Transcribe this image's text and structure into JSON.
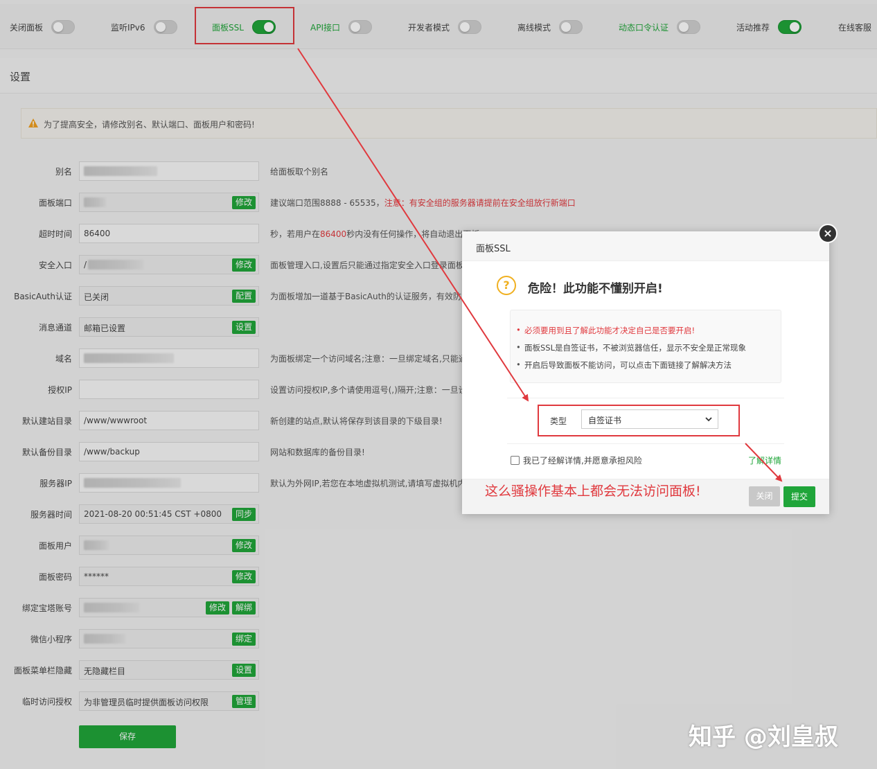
{
  "toggles": [
    {
      "label": "关闭面板",
      "on": false,
      "accent": false
    },
    {
      "label": "监听IPv6",
      "on": false,
      "accent": false
    },
    {
      "label": "面板SSL",
      "on": true,
      "accent": true
    },
    {
      "label": "API接口",
      "on": false,
      "accent": true
    },
    {
      "label": "开发者模式",
      "on": false,
      "accent": false
    },
    {
      "label": "离线模式",
      "on": false,
      "accent": false
    },
    {
      "label": "动态口令认证",
      "on": false,
      "accent": true
    },
    {
      "label": "活动推荐",
      "on": true,
      "accent": false
    },
    {
      "label": "在线客服",
      "on": false,
      "accent": false
    }
  ],
  "settings": {
    "title": "设置",
    "warning": "为了提高安全，请修改别名、默认端口、面板用户和密码!",
    "rows": [
      {
        "label": "别名",
        "value": "",
        "hint": "给面板取个别名"
      },
      {
        "label": "面板端口",
        "value": "",
        "btn": "修改",
        "hint": "建议端口范围8888 - 65535，",
        "hint_red": "注意：有安全组的服务器请提前在安全组放行新端口"
      },
      {
        "label": "超时时间",
        "value": "86400",
        "hint": "秒，若用户在",
        "hint_red": "86400",
        "hint_after": "秒内没有任何操作，将自动退出面板"
      },
      {
        "label": "安全入口",
        "value": "/",
        "btn": "修改",
        "hint": "面板管理入口,设置后只能通过指定安全入口登录面板"
      },
      {
        "label": "BasicAuth认证",
        "value": "已关闭",
        "btn": "配置",
        "hint": "为面板增加一道基于BasicAuth的认证服务，有效防"
      },
      {
        "label": "消息通道",
        "value": "邮箱已设置",
        "btn": "设置",
        "hint": ""
      },
      {
        "label": "域名",
        "value": "",
        "hint": "为面板绑定一个访问域名;注意：一旦绑定域名,只能通"
      },
      {
        "label": "授权IP",
        "value": "",
        "hint": "设置访问授权IP,多个请使用逗号(,)隔开;注意：一旦设"
      },
      {
        "label": "默认建站目录",
        "value": "/www/wwwroot",
        "hint": "新创建的站点,默认将保存到该目录的下级目录!"
      },
      {
        "label": "默认备份目录",
        "value": "/www/backup",
        "hint": "网站和数据库的备份目录!"
      },
      {
        "label": "服务器IP",
        "value": "",
        "hint": "默认为外网IP,若您在本地虚拟机测试,请填写虚拟机内"
      },
      {
        "label": "服务器时间",
        "value": "2021-08-20 00:51:45 CST +0800",
        "btn": "同步",
        "hint": ""
      },
      {
        "label": "面板用户",
        "value": "",
        "btn": "修改",
        "hint": ""
      },
      {
        "label": "面板密码",
        "value": "******",
        "btn": "修改",
        "hint": ""
      },
      {
        "label": "绑定宝塔账号",
        "value": "",
        "btn": "修改",
        "btn2": "解绑",
        "hint": ""
      },
      {
        "label": "微信小程序",
        "value": "",
        "btn": "绑定",
        "hint": ""
      },
      {
        "label": "面板菜单栏隐藏",
        "value": "无隐藏栏目",
        "btn": "设置",
        "hint": ""
      },
      {
        "label": "临时访问授权",
        "value": "为非管理员临时提供面板访问权限",
        "btn": "管理",
        "hint": ""
      }
    ],
    "save_label": "保存"
  },
  "modal": {
    "title": "面板SSL",
    "heading": "危险！此功能不懂别开启!",
    "items": [
      "必须要用到且了解此功能才决定自己是否要开启!",
      "面板SSL是自签证书，不被浏览器信任，显示不安全是正常现象",
      "开启后导致面板不能访问，可以点击下面链接了解解决方法"
    ],
    "type_label": "类型",
    "type_value": "自签证书",
    "agree_text": "我已了经解详情,并愿意承担风险",
    "learn_more": "了解详情",
    "close_label": "关闭",
    "submit_label": "提交"
  },
  "annotation": "这么骚操作基本上都会无法访问面板!",
  "watermark": "知乎 @刘皇叔",
  "colors": {
    "accent": "#20a53a",
    "danger": "#e0393e",
    "warn": "#f0b020"
  }
}
